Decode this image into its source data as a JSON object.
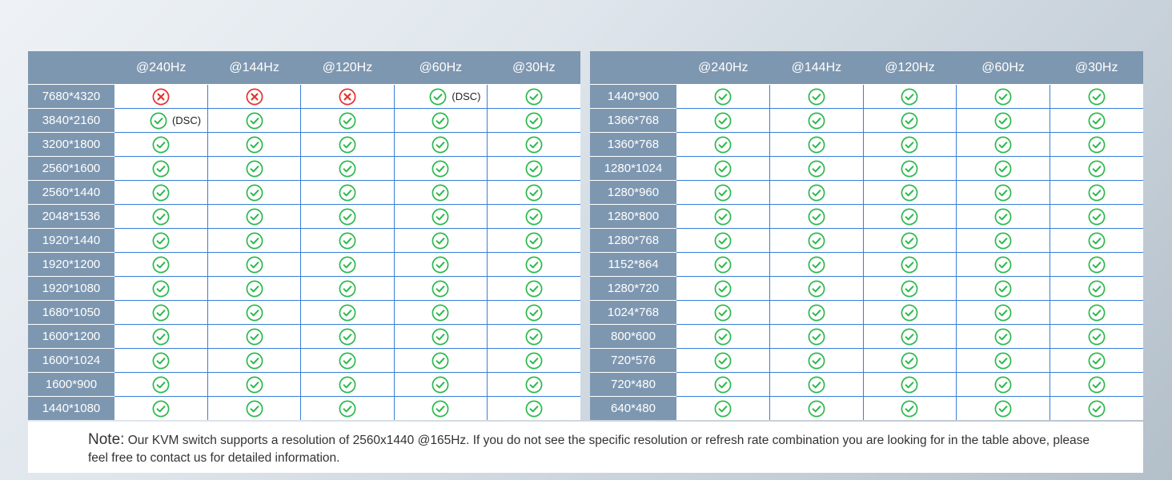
{
  "colors": {
    "header_bg": "#7e97b0",
    "grid_line": "#3a7fd8",
    "check_green": "#2bb94c",
    "cross_red": "#e5322d"
  },
  "icons": {
    "supported": "check-circle-icon",
    "unsupported": "cross-circle-icon"
  },
  "left_table": {
    "headers": [
      "",
      "@240Hz",
      "@144Hz",
      "@120Hz",
      "@60Hz",
      "@30Hz"
    ],
    "rows": [
      {
        "res": "7680*4320",
        "cells": [
          {
            "s": "x"
          },
          {
            "s": "x"
          },
          {
            "s": "x"
          },
          {
            "s": "check",
            "note": "(DSC)"
          },
          {
            "s": "check"
          }
        ]
      },
      {
        "res": "3840*2160",
        "cells": [
          {
            "s": "check",
            "note": "(DSC)"
          },
          {
            "s": "check"
          },
          {
            "s": "check"
          },
          {
            "s": "check"
          },
          {
            "s": "check"
          }
        ]
      },
      {
        "res": "3200*1800",
        "cells": [
          {
            "s": "check"
          },
          {
            "s": "check"
          },
          {
            "s": "check"
          },
          {
            "s": "check"
          },
          {
            "s": "check"
          }
        ]
      },
      {
        "res": "2560*1600",
        "cells": [
          {
            "s": "check"
          },
          {
            "s": "check"
          },
          {
            "s": "check"
          },
          {
            "s": "check"
          },
          {
            "s": "check"
          }
        ]
      },
      {
        "res": "2560*1440",
        "cells": [
          {
            "s": "check"
          },
          {
            "s": "check"
          },
          {
            "s": "check"
          },
          {
            "s": "check"
          },
          {
            "s": "check"
          }
        ]
      },
      {
        "res": "2048*1536",
        "cells": [
          {
            "s": "check"
          },
          {
            "s": "check"
          },
          {
            "s": "check"
          },
          {
            "s": "check"
          },
          {
            "s": "check"
          }
        ]
      },
      {
        "res": "1920*1440",
        "cells": [
          {
            "s": "check"
          },
          {
            "s": "check"
          },
          {
            "s": "check"
          },
          {
            "s": "check"
          },
          {
            "s": "check"
          }
        ]
      },
      {
        "res": "1920*1200",
        "cells": [
          {
            "s": "check"
          },
          {
            "s": "check"
          },
          {
            "s": "check"
          },
          {
            "s": "check"
          },
          {
            "s": "check"
          }
        ]
      },
      {
        "res": "1920*1080",
        "cells": [
          {
            "s": "check"
          },
          {
            "s": "check"
          },
          {
            "s": "check"
          },
          {
            "s": "check"
          },
          {
            "s": "check"
          }
        ]
      },
      {
        "res": "1680*1050",
        "cells": [
          {
            "s": "check"
          },
          {
            "s": "check"
          },
          {
            "s": "check"
          },
          {
            "s": "check"
          },
          {
            "s": "check"
          }
        ]
      },
      {
        "res": "1600*1200",
        "cells": [
          {
            "s": "check"
          },
          {
            "s": "check"
          },
          {
            "s": "check"
          },
          {
            "s": "check"
          },
          {
            "s": "check"
          }
        ]
      },
      {
        "res": "1600*1024",
        "cells": [
          {
            "s": "check"
          },
          {
            "s": "check"
          },
          {
            "s": "check"
          },
          {
            "s": "check"
          },
          {
            "s": "check"
          }
        ]
      },
      {
        "res": "1600*900",
        "cells": [
          {
            "s": "check"
          },
          {
            "s": "check"
          },
          {
            "s": "check"
          },
          {
            "s": "check"
          },
          {
            "s": "check"
          }
        ]
      },
      {
        "res": "1440*1080",
        "cells": [
          {
            "s": "check"
          },
          {
            "s": "check"
          },
          {
            "s": "check"
          },
          {
            "s": "check"
          },
          {
            "s": "check"
          }
        ]
      }
    ]
  },
  "right_table": {
    "headers": [
      "",
      "@240Hz",
      "@144Hz",
      "@120Hz",
      "@60Hz",
      "@30Hz"
    ],
    "rows": [
      {
        "res": "1440*900",
        "cells": [
          {
            "s": "check"
          },
          {
            "s": "check"
          },
          {
            "s": "check"
          },
          {
            "s": "check"
          },
          {
            "s": "check"
          }
        ]
      },
      {
        "res": "1366*768",
        "cells": [
          {
            "s": "check"
          },
          {
            "s": "check"
          },
          {
            "s": "check"
          },
          {
            "s": "check"
          },
          {
            "s": "check"
          }
        ]
      },
      {
        "res": "1360*768",
        "cells": [
          {
            "s": "check"
          },
          {
            "s": "check"
          },
          {
            "s": "check"
          },
          {
            "s": "check"
          },
          {
            "s": "check"
          }
        ]
      },
      {
        "res": "1280*1024",
        "cells": [
          {
            "s": "check"
          },
          {
            "s": "check"
          },
          {
            "s": "check"
          },
          {
            "s": "check"
          },
          {
            "s": "check"
          }
        ]
      },
      {
        "res": "1280*960",
        "cells": [
          {
            "s": "check"
          },
          {
            "s": "check"
          },
          {
            "s": "check"
          },
          {
            "s": "check"
          },
          {
            "s": "check"
          }
        ]
      },
      {
        "res": "1280*800",
        "cells": [
          {
            "s": "check"
          },
          {
            "s": "check"
          },
          {
            "s": "check"
          },
          {
            "s": "check"
          },
          {
            "s": "check"
          }
        ]
      },
      {
        "res": "1280*768",
        "cells": [
          {
            "s": "check"
          },
          {
            "s": "check"
          },
          {
            "s": "check"
          },
          {
            "s": "check"
          },
          {
            "s": "check"
          }
        ]
      },
      {
        "res": "1152*864",
        "cells": [
          {
            "s": "check"
          },
          {
            "s": "check"
          },
          {
            "s": "check"
          },
          {
            "s": "check"
          },
          {
            "s": "check"
          }
        ]
      },
      {
        "res": "1280*720",
        "cells": [
          {
            "s": "check"
          },
          {
            "s": "check"
          },
          {
            "s": "check"
          },
          {
            "s": "check"
          },
          {
            "s": "check"
          }
        ]
      },
      {
        "res": "1024*768",
        "cells": [
          {
            "s": "check"
          },
          {
            "s": "check"
          },
          {
            "s": "check"
          },
          {
            "s": "check"
          },
          {
            "s": "check"
          }
        ]
      },
      {
        "res": "800*600",
        "cells": [
          {
            "s": "check"
          },
          {
            "s": "check"
          },
          {
            "s": "check"
          },
          {
            "s": "check"
          },
          {
            "s": "check"
          }
        ]
      },
      {
        "res": "720*576",
        "cells": [
          {
            "s": "check"
          },
          {
            "s": "check"
          },
          {
            "s": "check"
          },
          {
            "s": "check"
          },
          {
            "s": "check"
          }
        ]
      },
      {
        "res": "720*480",
        "cells": [
          {
            "s": "check"
          },
          {
            "s": "check"
          },
          {
            "s": "check"
          },
          {
            "s": "check"
          },
          {
            "s": "check"
          }
        ]
      },
      {
        "res": "640*480",
        "cells": [
          {
            "s": "check"
          },
          {
            "s": "check"
          },
          {
            "s": "check"
          },
          {
            "s": "check"
          },
          {
            "s": "check"
          }
        ]
      }
    ]
  },
  "note": {
    "label": "Note:",
    "text": "Our KVM switch supports a resolution of 2560x1440 @165Hz. If you do not see the specific resolution or refresh rate combination you are looking for in the table above, please feel free to contact us for detailed information."
  }
}
